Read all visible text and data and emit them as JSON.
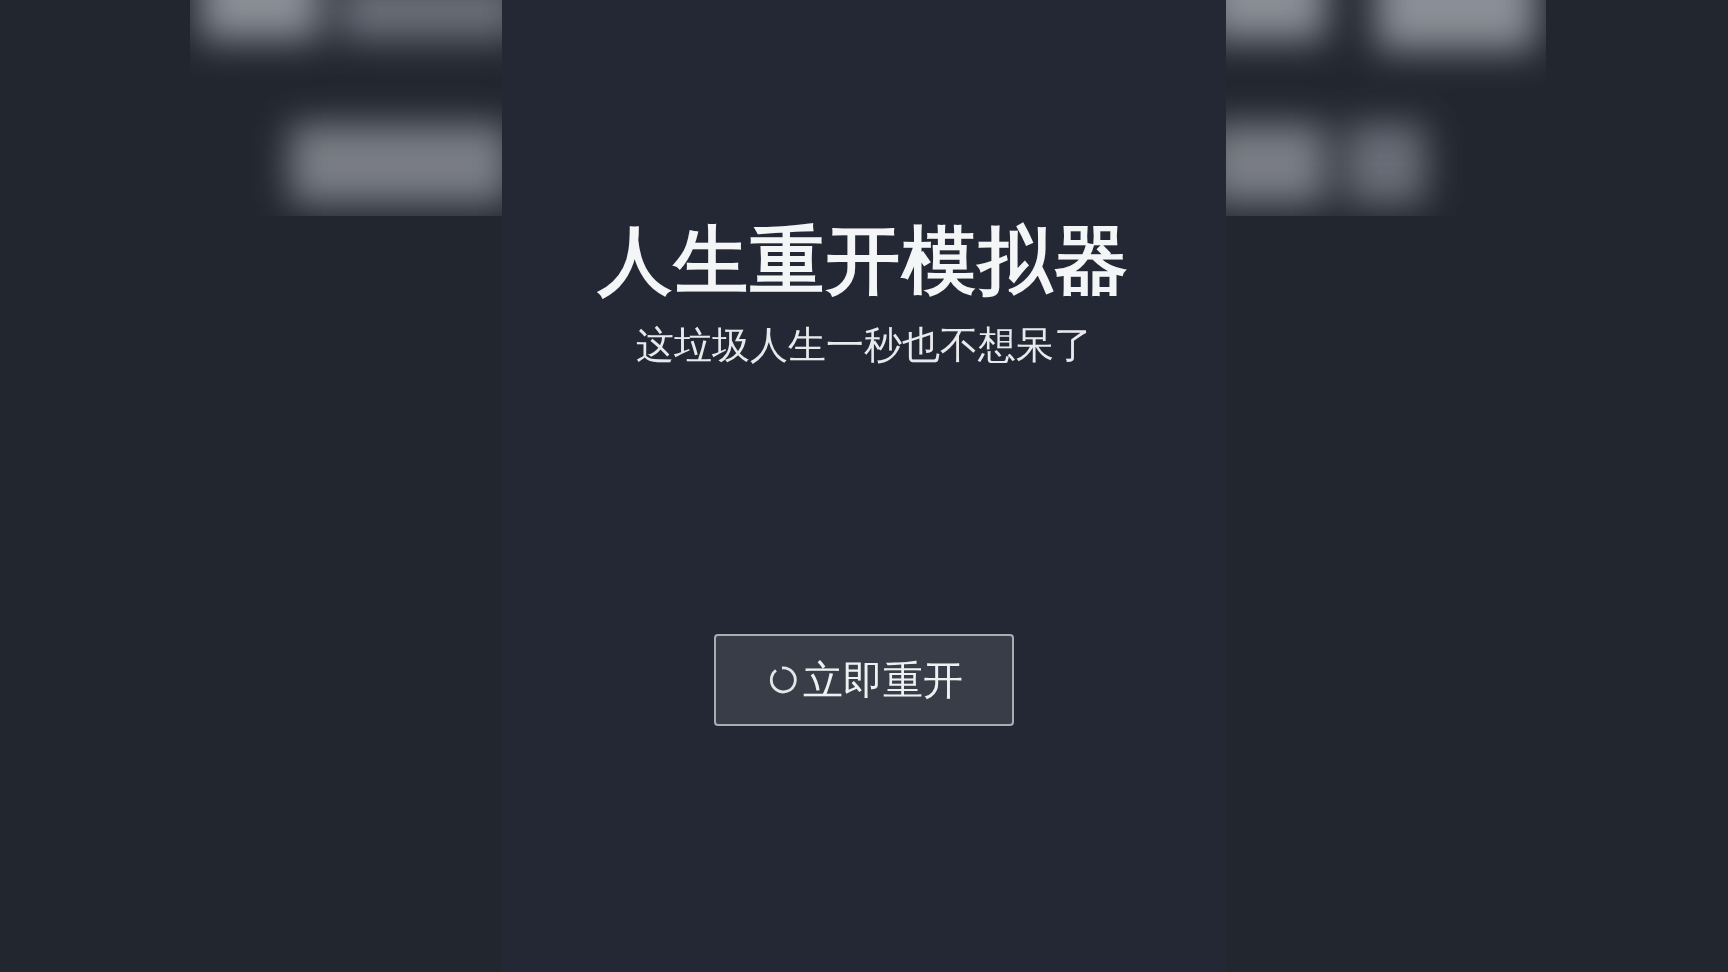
{
  "title": "人生重开模拟器",
  "subtitle": "这垃圾人生一秒也不想呆了",
  "button": {
    "label": "立即重开"
  }
}
